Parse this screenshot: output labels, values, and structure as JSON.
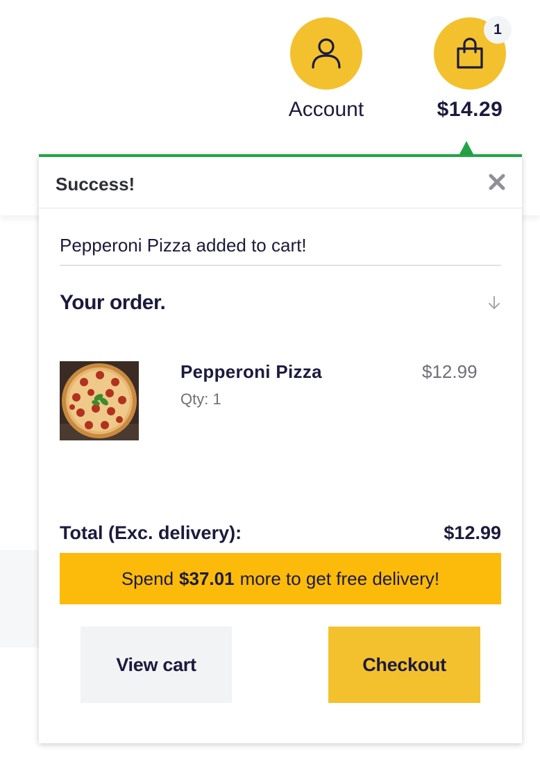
{
  "header": {
    "account_label": "Account",
    "cart_badge_count": "1",
    "cart_total": "$14.29"
  },
  "popup": {
    "status_title": "Success!",
    "added_message": "Pepperoni Pizza added to cart!",
    "order_title": "Your order.",
    "items": [
      {
        "name": "Pepperoni Pizza",
        "qty": "Qty: 1",
        "price": "$12.99",
        "image_icon": "pepperoni-pizza-photo"
      }
    ],
    "total_label": "Total (Exc. delivery):",
    "total_value": "$12.99",
    "delivery": {
      "prefix": "Spend",
      "amount": "$37.01",
      "suffix": "more to get free delivery!"
    },
    "view_cart_label": "View cart",
    "checkout_label": "Checkout"
  },
  "colors": {
    "accent_yellow": "#f3c12e",
    "delivery_bar": "#fcbb0a",
    "success_green": "#22a447",
    "text_dark": "#1c1a3d"
  }
}
